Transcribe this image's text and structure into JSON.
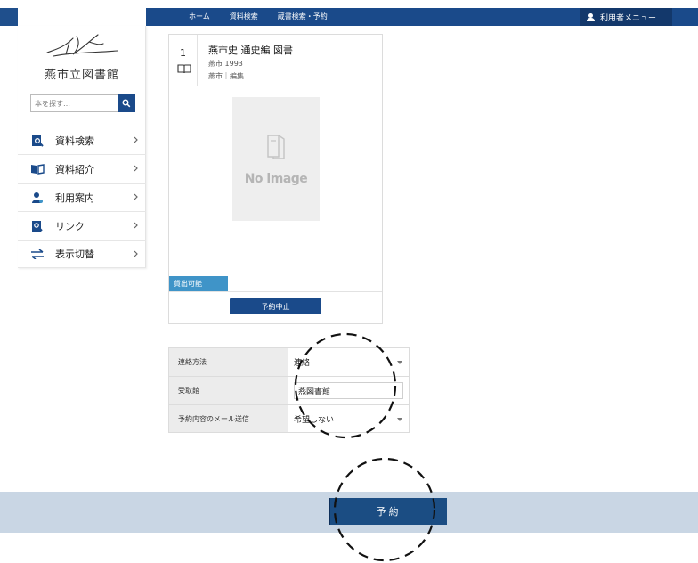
{
  "header": {
    "breadcrumbs": [
      "ホーム",
      "資料検索",
      "蔵書検索・予約"
    ],
    "user_menu_label": "利用者メニュー"
  },
  "sidebar": {
    "library_name": "燕市立図書館",
    "search": {
      "placeholder": "本を探す…"
    },
    "items": [
      {
        "label": "資料検索",
        "icon": "search-doc-icon"
      },
      {
        "label": "資料紹介",
        "icon": "open-book-icon"
      },
      {
        "label": "利用案内",
        "icon": "user-guide-icon"
      },
      {
        "label": "リンク",
        "icon": "link-doc-icon"
      },
      {
        "label": "表示切替",
        "icon": "swap-arrows-icon"
      }
    ]
  },
  "book": {
    "number": "1",
    "title": "燕市史 通史編 図書",
    "meta_line1": "燕市 1993",
    "meta_line2": "燕市｜編集",
    "no_image_text": "No image",
    "status": "貸出可能",
    "cancel_label": "予約中止"
  },
  "form": {
    "rows": [
      {
        "label": "連絡方法",
        "value": "連絡",
        "type": "select"
      },
      {
        "label": "受取館",
        "value": "燕図書館",
        "type": "text"
      },
      {
        "label": "予約内容のメール送信",
        "value": "希望しない",
        "type": "select"
      }
    ]
  },
  "footer": {
    "reserve_label": "予約"
  },
  "colors": {
    "header_blue": "#1a4a8a",
    "status_blue": "#3f94c8",
    "bottom_bar": "#c9d6e4"
  }
}
